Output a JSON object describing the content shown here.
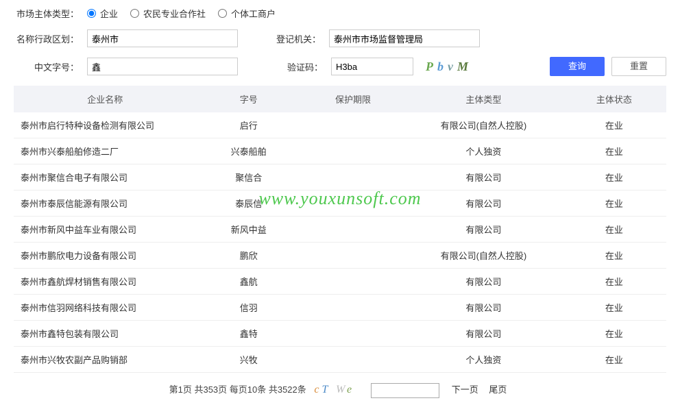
{
  "watermark": "www.youxunsoft.com",
  "form": {
    "entityTypeLabel": "市场主体类型：",
    "radios": {
      "enterprise": "企业",
      "coop": "农民专业合作社",
      "individual": "个体工商户"
    },
    "regionLabel": "名称行政区划：",
    "regionValue": "泰州市",
    "registryLabel": "登记机关：",
    "registryValue": "泰州市市场监督管理局",
    "cnNameLabel": "中文字号：",
    "cnNameValue": "鑫",
    "captchaLabel": "验证码：",
    "captchaValue": "H3ba",
    "captchaImg": {
      "c1": "P",
      "c2": "b",
      "c3": "v",
      "c4": "M"
    },
    "queryBtn": "查询",
    "resetBtn": "重置"
  },
  "table": {
    "headers": {
      "name": "企业名称",
      "brand": "字号",
      "period": "保护期限",
      "type": "主体类型",
      "status": "主体状态"
    },
    "rows": [
      {
        "name": "泰州市启行特种设备检测有限公司",
        "brand": "启行",
        "period": "",
        "type": "有限公司(自然人控股)",
        "status": "在业"
      },
      {
        "name": "泰州市兴泰船舶修造二厂",
        "brand": "兴泰船舶",
        "period": "",
        "type": "个人独资",
        "status": "在业"
      },
      {
        "name": "泰州市聚信合电子有限公司",
        "brand": "聚信合",
        "period": "",
        "type": "有限公司",
        "status": "在业"
      },
      {
        "name": "泰州市泰辰信能源有限公司",
        "brand": "泰辰信",
        "period": "",
        "type": "有限公司",
        "status": "在业"
      },
      {
        "name": "泰州市新风中益车业有限公司",
        "brand": "新风中益",
        "period": "",
        "type": "有限公司",
        "status": "在业"
      },
      {
        "name": "泰州市鹏欣电力设备有限公司",
        "brand": "鹏欣",
        "period": "",
        "type": "有限公司(自然人控股)",
        "status": "在业"
      },
      {
        "name": "泰州市鑫航焊材销售有限公司",
        "brand": "鑫航",
        "period": "",
        "type": "有限公司",
        "status": "在业"
      },
      {
        "name": "泰州市信羽网络科技有限公司",
        "brand": "信羽",
        "period": "",
        "type": "有限公司",
        "status": "在业"
      },
      {
        "name": "泰州市鑫特包装有限公司",
        "brand": "鑫特",
        "period": "",
        "type": "有限公司",
        "status": "在业"
      },
      {
        "name": "泰州市兴牧农副产品购销部",
        "brand": "兴牧",
        "period": "",
        "type": "个人独资",
        "status": "在业"
      }
    ]
  },
  "pagination": {
    "summary": "第1页  共353页  每页10条  共3522条",
    "captcha": {
      "p1": "c",
      "p2": "T",
      "p3": "W",
      "p4": "e"
    },
    "nextLabel": "下一页",
    "lastLabel": "尾页"
  }
}
